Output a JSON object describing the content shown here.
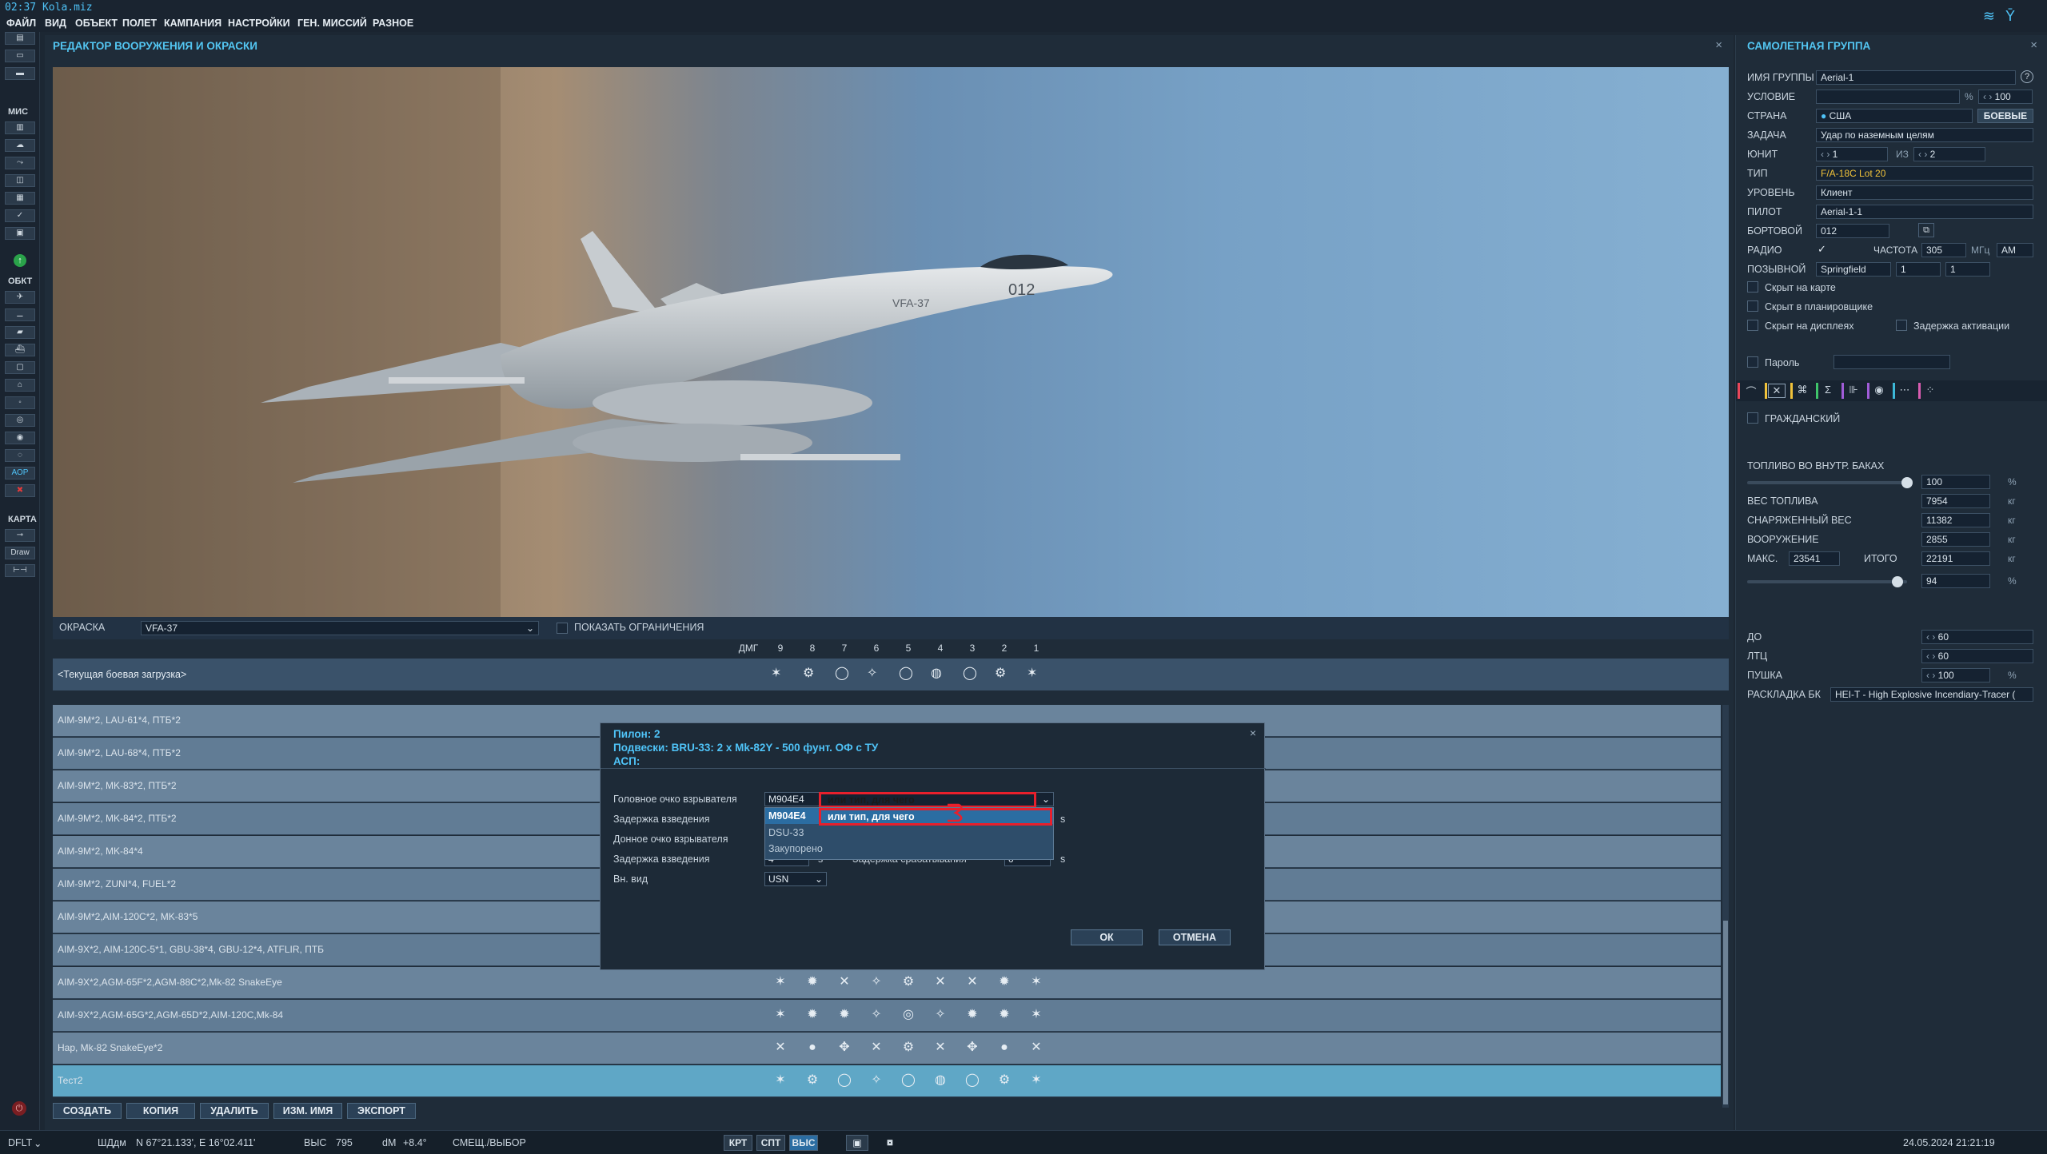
{
  "window": {
    "title": "02:37 Kola.miz"
  },
  "menu": [
    "ФАЙЛ",
    "ВИД",
    "ОБЪЕКТ",
    "ПОЛЕТ",
    "КАМПАНИЯ",
    "НАСТРОЙКИ",
    "ГЕН. МИССИЙ",
    "РАЗНОЕ"
  ],
  "left_toolbar": {
    "sections": [
      "МИС",
      "ОБКТ",
      "КАРТА"
    ],
    "draw_label": "Draw"
  },
  "editor": {
    "title": "РЕДАКТОР ВООРУЖЕНИЯ И ОКРАСКИ",
    "close": "×",
    "livery_label": "ОКРАСКА",
    "livery_value": "VFA-37",
    "show_limits_label": "ПОКАЗАТЬ ОГРАНИЧЕНИЯ",
    "columns": [
      "ДМГ",
      "9",
      "8",
      "7",
      "6",
      "5",
      "4",
      "3",
      "2",
      "1"
    ],
    "current_loadout": "<Текущая боевая загрузка>",
    "loadouts": [
      "AIM-9M*2, LAU-61*4, ПТБ*2",
      "AIM-9M*2, LAU-68*4, ПТБ*2",
      "AIM-9M*2, MK-83*2, ПТБ*2",
      "AIM-9M*2, MK-84*2, ПТБ*2",
      "AIM-9M*2, MK-84*4",
      "AIM-9M*2, ZUNI*4, FUEL*2",
      "AIM-9M*2,AIM-120C*2, MK-83*5",
      "AIM-9X*2, AIM-120C-5*1, GBU-38*4, GBU-12*4, ATFLIR, ПТБ",
      "AIM-9X*2,AGM-65F*2,AGM-88C*2,Mk-82 SnakeEye",
      "AIM-9X*2,AGM-65G*2,AGM-65D*2,AIM-120C,Mk-84",
      "Hap, Mk-82 SnakeEye*2",
      "Тест2"
    ],
    "buttons": [
      "СОЗДАТЬ",
      "КОПИЯ",
      "УДАЛИТЬ",
      "ИЗМ. ИМЯ",
      "ЭКСПОРТ"
    ]
  },
  "dialog": {
    "pylon": "Пилон: 2",
    "suspension": "Подвески: BRU-33: 2 x Mk-82Y - 500 фунт. ОФ с ТУ",
    "asp": "АСП:",
    "labels": {
      "nose_fuze": "Головное очко взрывателя",
      "arm_delay": "Задержка взведения",
      "tail_fuze": "Донное очко взрывателя",
      "arm_delay2": "Задержка взведения",
      "trigger_delay": "Задержка срабатывания",
      "ext_view": "Вн. вид"
    },
    "nose_fuze_value": "M904E4",
    "annotation_text": "или тип, для чего",
    "dropdown_items": [
      "M904E4",
      "DSU-33",
      "Закупорено"
    ],
    "arm_delay_value": "4",
    "trigger_delay_value": "0",
    "unit_s": "s",
    "ext_view_value": "USN",
    "ok": "ОК",
    "cancel": "ОТМЕНА"
  },
  "group_panel": {
    "title": "САМОЛЕТНАЯ ГРУППА",
    "fields": {
      "group_name_label": "ИМЯ ГРУППЫ",
      "group_name": "Aerial-1",
      "condition_label": "УСЛОВИЕ",
      "condition_pct": "100",
      "country_label": "СТРАНА",
      "country": "США",
      "combat_btn": "БОЕВЫЕ",
      "task_label": "ЗАДАЧА",
      "task": "Удар по наземным целям",
      "unit_label": "ЮНИТ",
      "unit": "1",
      "of_label": "ИЗ",
      "of": "2",
      "type_label": "ТИП",
      "type": "F/A-18C Lot 20",
      "level_label": "УРОВЕНЬ",
      "level": "Клиент",
      "pilot_label": "ПИЛОТ",
      "pilot": "Aerial-1-1",
      "tail_label": "БОРТОВОЙ",
      "tail": "012",
      "radio_label": "РАДИО",
      "freq_label": "ЧАСТОТА",
      "freq": "305",
      "freq_unit": "МГц",
      "modulation": "AM",
      "callsign_label": "ПОЗЫВНОЙ",
      "callsign": "Springfield",
      "callsign_n1": "1",
      "callsign_n2": "1"
    },
    "checkboxes": [
      "Скрыт на карте",
      "Скрыт в планировщике",
      "Скрыт на дисплеях",
      "Задержка активации",
      "Пароль",
      "ГРАЖДАНСКИЙ"
    ],
    "fuel": {
      "internal_label": "ТОПЛИВО ВО ВНУТР. БАКАХ",
      "internal_pct": "100",
      "fuel_weight_label": "ВЕС ТОПЛИВА",
      "fuel_weight": "7954",
      "gross_label": "СНАРЯЖЕННЫЙ ВЕС",
      "gross": "11382",
      "weapons_label": "ВООРУЖЕНИЕ",
      "weapons": "2855",
      "max_label": "МАКС.",
      "max": "23541",
      "total_label": "ИТОГО",
      "total": "22191",
      "total_pct": "94",
      "internal_fill": 1.0,
      "total_fill": 0.94,
      "unit_kg": "кг",
      "unit_pct": "%"
    },
    "stores": {
      "chaff_label": "ДО",
      "chaff": "60",
      "flare_label": "ЛТЦ",
      "flare": "60",
      "gun_label": "ПУШКА",
      "gun": "100",
      "ammo_label": "РАСКЛАДКА БК",
      "ammo": "HEI-T - High Explosive Incendiary-Tracer ("
    }
  },
  "status": {
    "profile": "DFLT",
    "coords_label": "ШДдм",
    "coords": "N 67°21.133', E 16°02.411'",
    "alt_label": "ВЫС",
    "alt": "795",
    "dm_label": "dM",
    "dm": "+8.4°",
    "mode": "СМЕЩ./ВЫБОР",
    "btns": [
      "КРТ",
      "СПТ",
      "ВЫС"
    ],
    "datetime": "24.05.2024 21:21:19"
  }
}
